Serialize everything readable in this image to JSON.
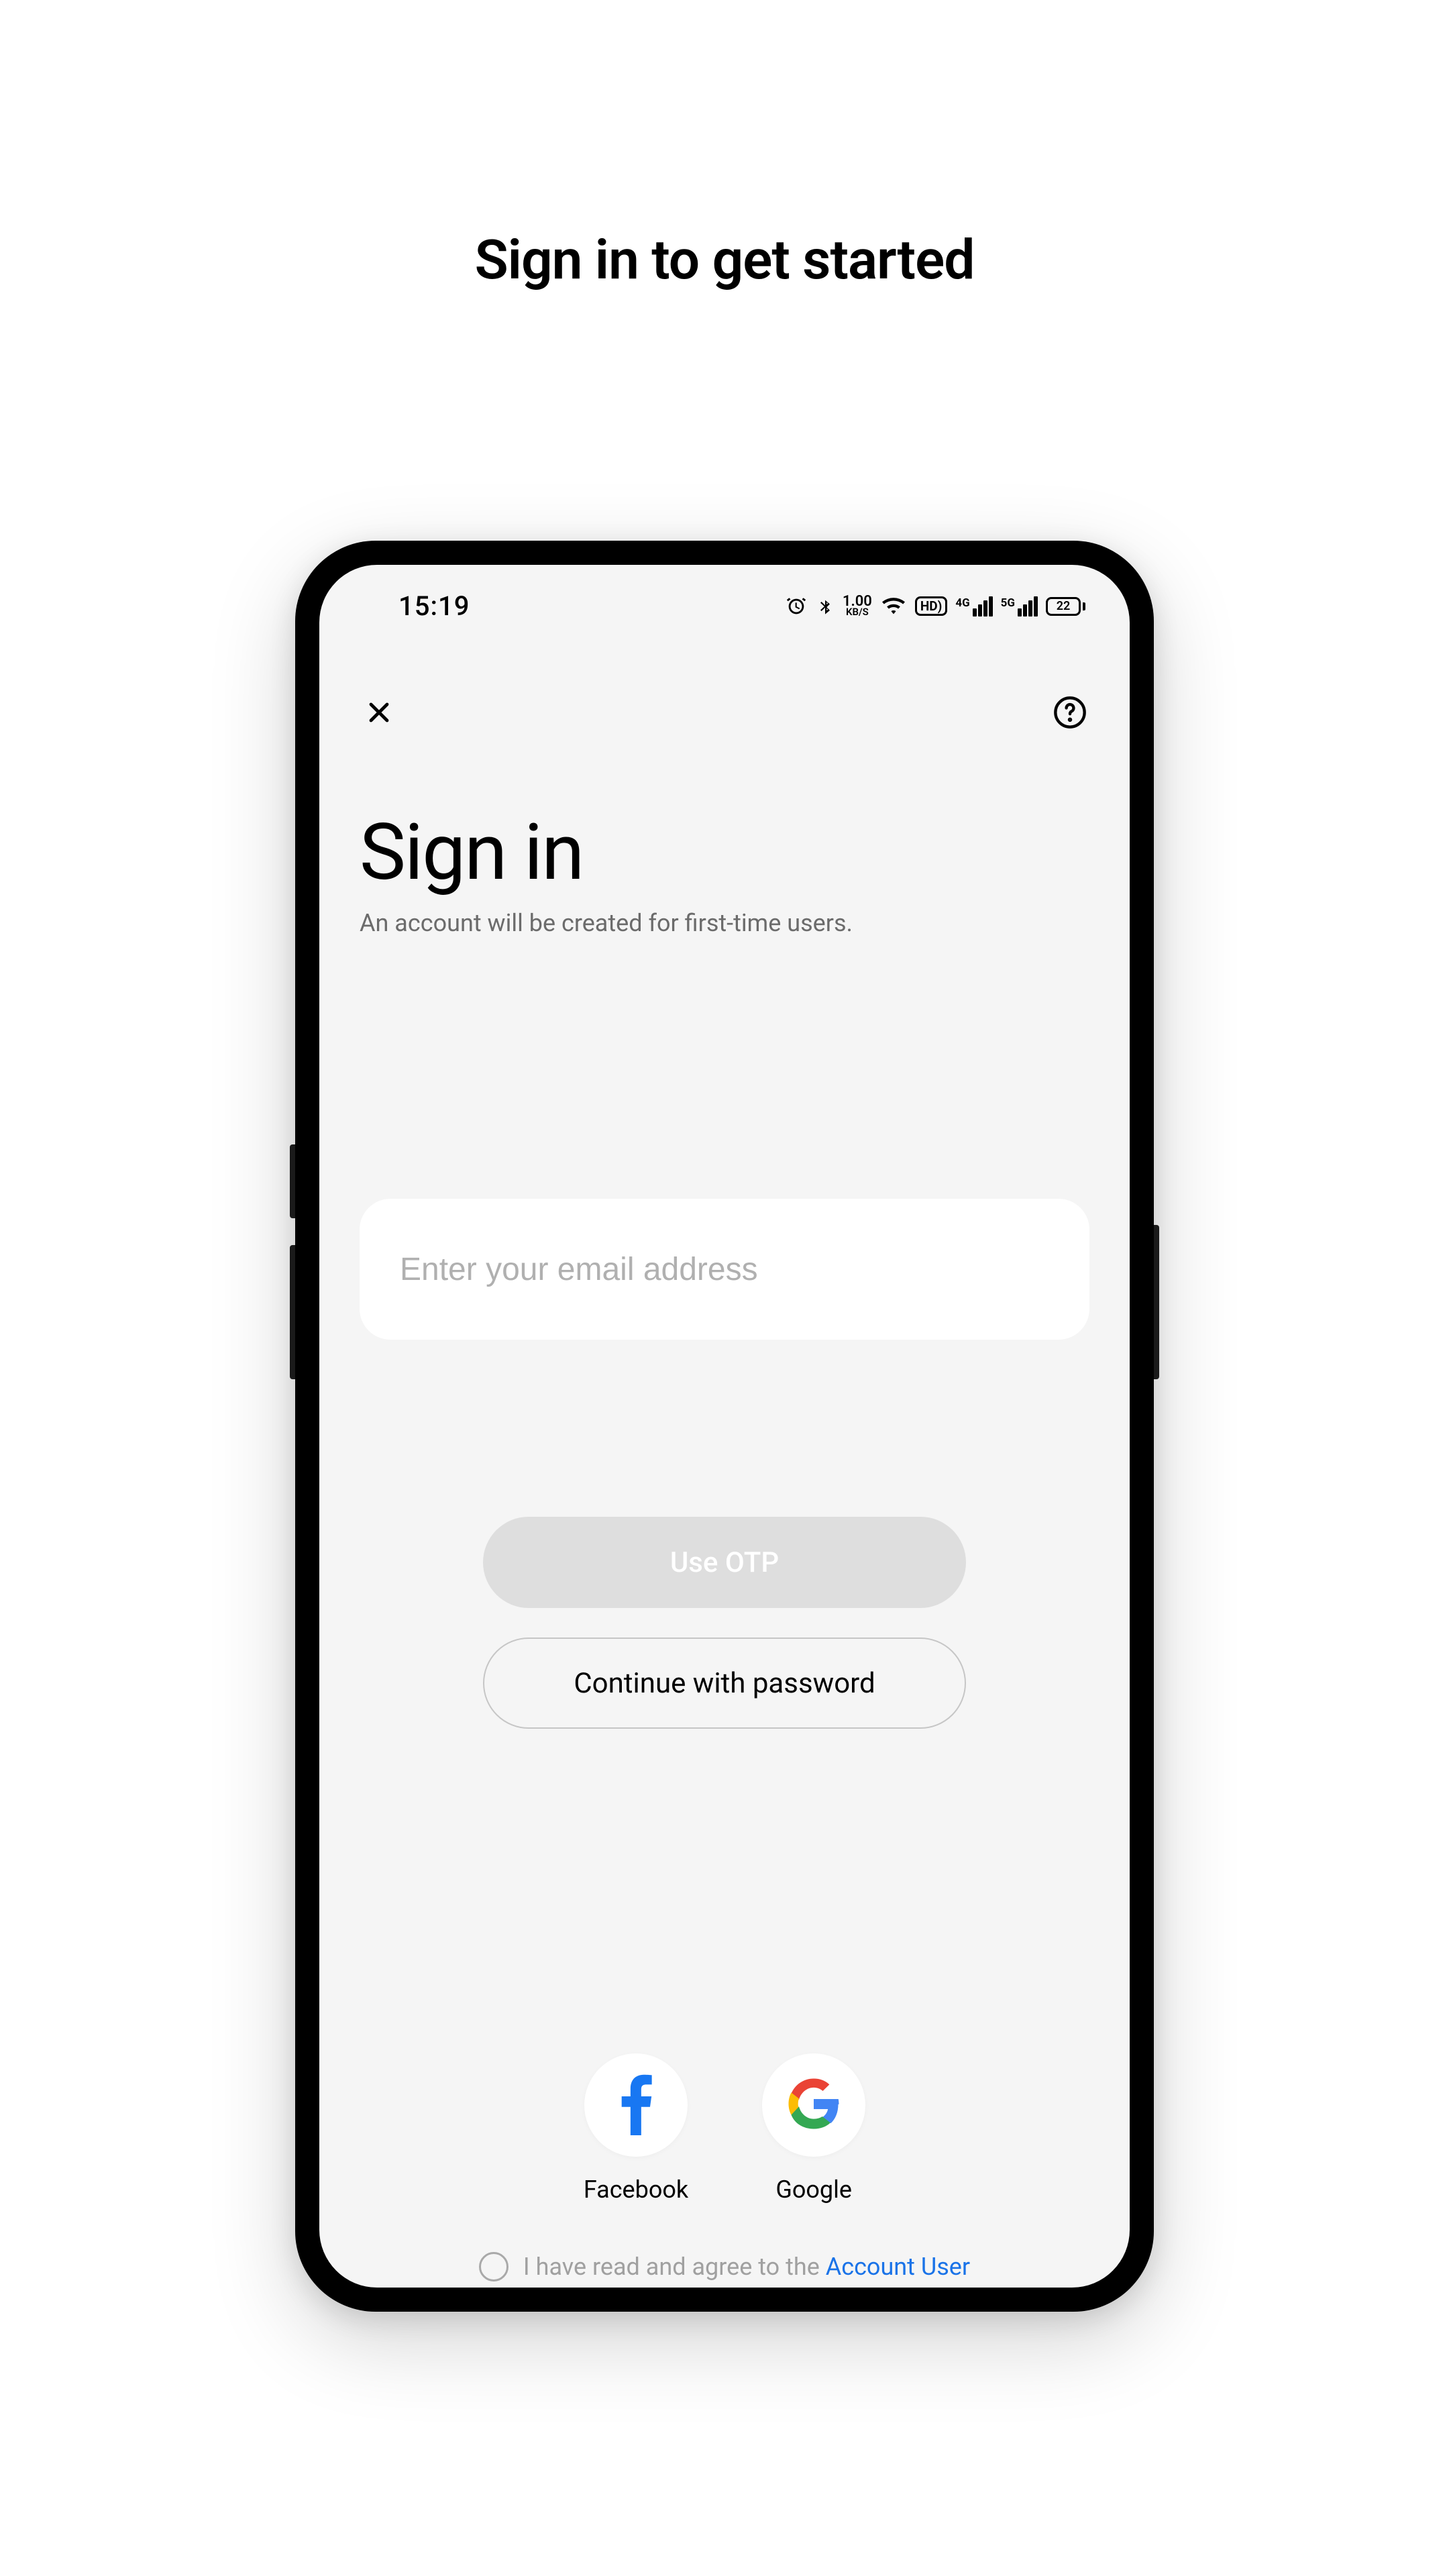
{
  "page_heading": "Sign in to get started",
  "status": {
    "time": "15:19",
    "data_rate_value": "1.00",
    "data_rate_unit": "KB/S",
    "hd_label": "HD)",
    "signal_4g_label": "4G",
    "signal_5g_label": "5G",
    "battery_level": "22"
  },
  "screen": {
    "title": "Sign in",
    "subtitle": "An account will be created for first-time users.",
    "email_placeholder": "Enter your email address",
    "otp_button": "Use OTP",
    "password_button": "Continue with password",
    "social": {
      "facebook": "Facebook",
      "google": "Google"
    },
    "agree_prefix": "I have read and agree to the ",
    "agree_link": "Account User"
  }
}
